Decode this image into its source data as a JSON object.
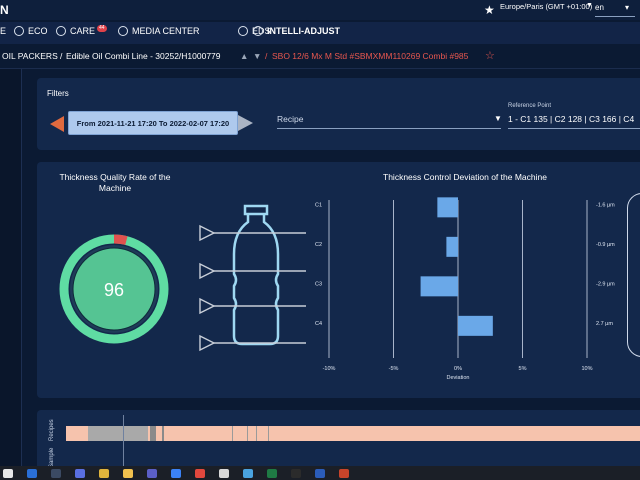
{
  "topbar": {
    "brand_fragment": "N",
    "timezone": "Europe/Paris (GMT +01:00)",
    "language": "en"
  },
  "nav": {
    "items": [
      {
        "label": "E"
      },
      {
        "label": "ECO"
      },
      {
        "label": "CARE",
        "badge": "44"
      },
      {
        "label": "MEDIA CENTER"
      },
      {
        "label": "EDS"
      },
      {
        "label": "INTELLI-ADJUST"
      }
    ]
  },
  "breadcrumb": {
    "customer": "OIL PACKERS",
    "line": "Edible Oil Combi Line - 30252/H1000779",
    "machine": "SBO 12/6 Mx M Std #SBMXMM110269 Combi #985",
    "sep": "/"
  },
  "filters": {
    "title": "Filters",
    "date_range": "From 2021-11-21 17:20 To 2022-02-07 17:20",
    "recipe_placeholder": "Recipe",
    "reference_point_label": "Reference Point",
    "reference_point_value": "1 - C1 135 | C2 128 | C3 166 | C4"
  },
  "quality": {
    "title": "Thickness Quality Rate of the Machine",
    "value": "96",
    "rate_fraction": 0.96,
    "color_good": "#5fdca3",
    "color_bad": "#e0524f"
  },
  "deviation": {
    "title": "Thickness Control Deviation of the Machine"
  },
  "chart_data": {
    "type": "bar",
    "orientation": "horizontal",
    "title": "Thickness Control Deviation of the Machine",
    "categories": [
      "C1",
      "C2",
      "C3",
      "C4"
    ],
    "values": [
      -1.6,
      -0.9,
      -2.9,
      2.7
    ],
    "value_labels": [
      "-1.6 µm",
      "-0.9 µm",
      "-2.9 µm",
      "2.7 µm"
    ],
    "xlabel": "Deviation",
    "xlim": [
      -10,
      10
    ],
    "ticks": [
      "-10%",
      "-5%",
      "0%",
      "5%",
      "10%"
    ],
    "tick_values": [
      -10,
      -5,
      0,
      5,
      10
    ],
    "bar_color": "#6aa8e8"
  },
  "timeline": {
    "recipes_label": "Recipes",
    "sample_label": "Sample"
  },
  "taskbar": {
    "icons": [
      "windows-icon",
      "search-icon",
      "taskview-icon",
      "files-icon",
      "mail-icon",
      "folder-icon",
      "teams-icon",
      "store-icon",
      "chrome-icon",
      "app-icon",
      "app2-icon",
      "excel-icon",
      "terminal-icon",
      "word-icon",
      "powerpoint-icon"
    ]
  }
}
